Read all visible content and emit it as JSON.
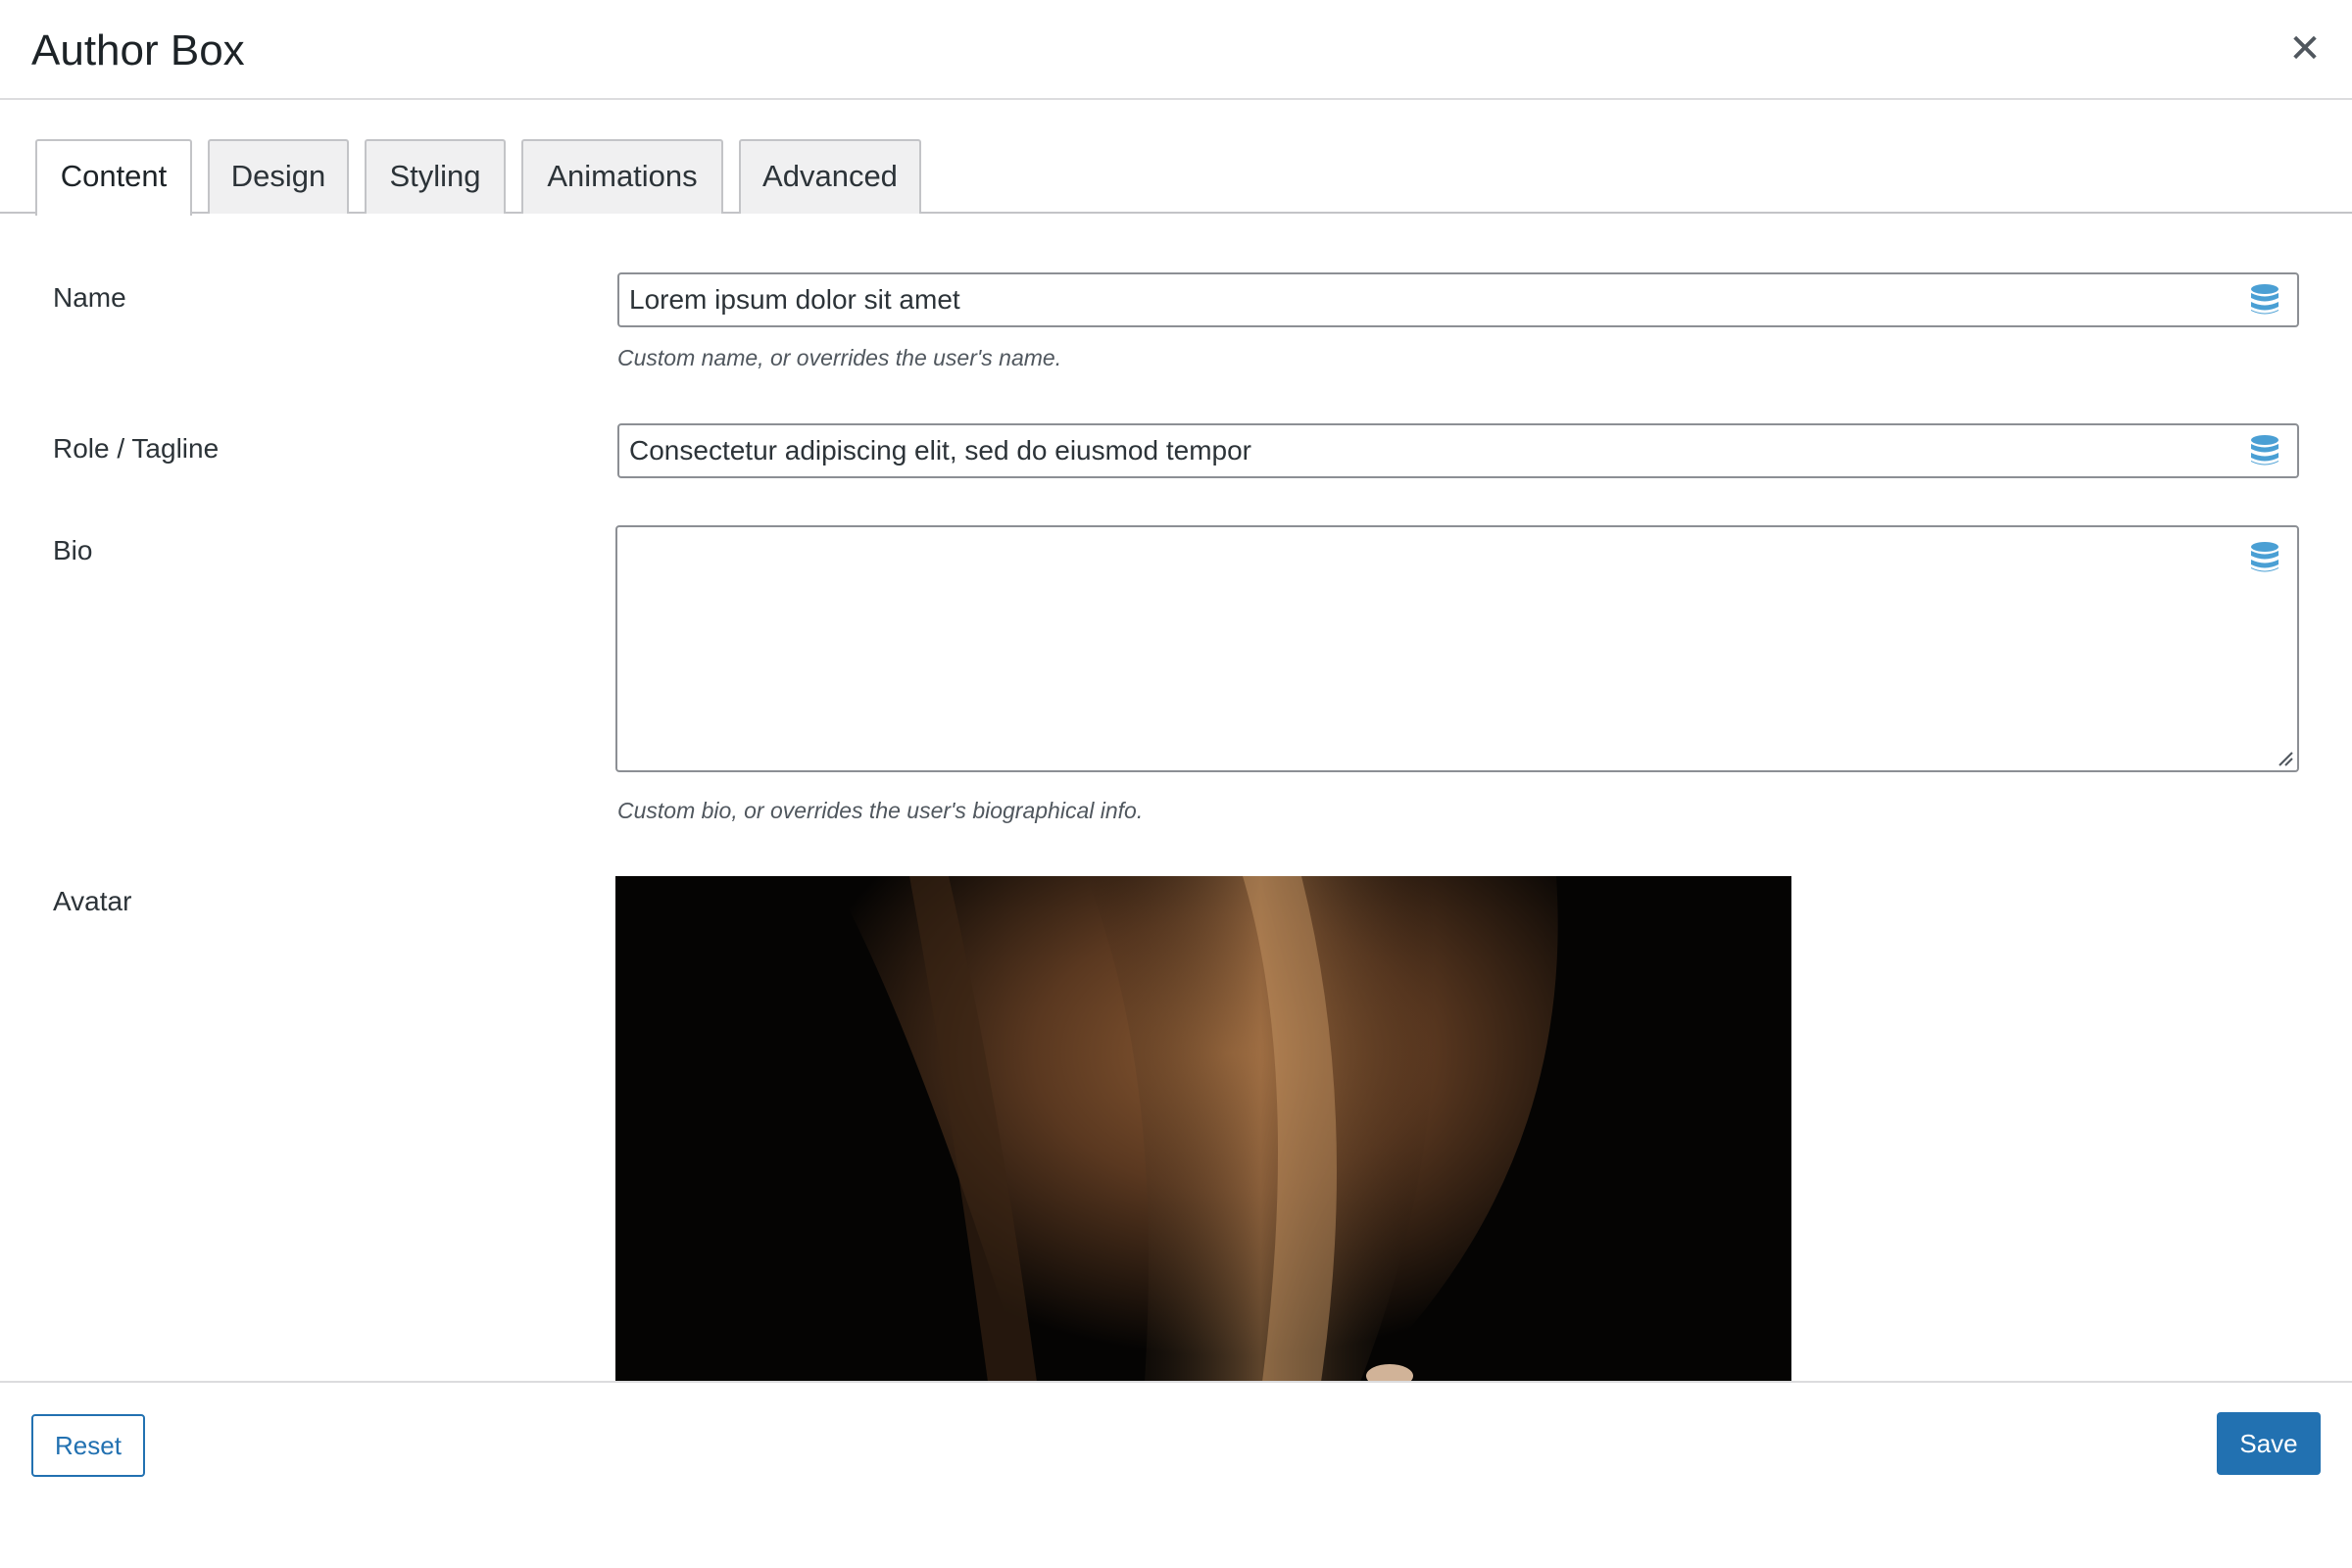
{
  "dialog": {
    "title": "Author Box",
    "close_icon": "close-icon"
  },
  "tabs": [
    {
      "label": "Content",
      "active": true
    },
    {
      "label": "Design",
      "active": false
    },
    {
      "label": "Styling",
      "active": false
    },
    {
      "label": "Animations",
      "active": false
    },
    {
      "label": "Advanced",
      "active": false
    }
  ],
  "form": {
    "name": {
      "label": "Name",
      "value": "Lorem ipsum dolor sit amet",
      "hint": "Custom name, or overrides the user's name.",
      "icon": "database-icon"
    },
    "role": {
      "label": "Role / Tagline",
      "value": "Consectetur adipiscing elit, sed do eiusmod tempor",
      "icon": "database-icon"
    },
    "bio": {
      "label": "Bio",
      "value": "",
      "hint": "Custom bio, or overrides the user's biographical info.",
      "icon": "database-icon"
    },
    "avatar": {
      "label": "Avatar"
    }
  },
  "footer": {
    "reset_label": "Reset",
    "save_label": "Save"
  },
  "colors": {
    "accent": "#2271b1",
    "db_icon": "#4a9fd4"
  }
}
